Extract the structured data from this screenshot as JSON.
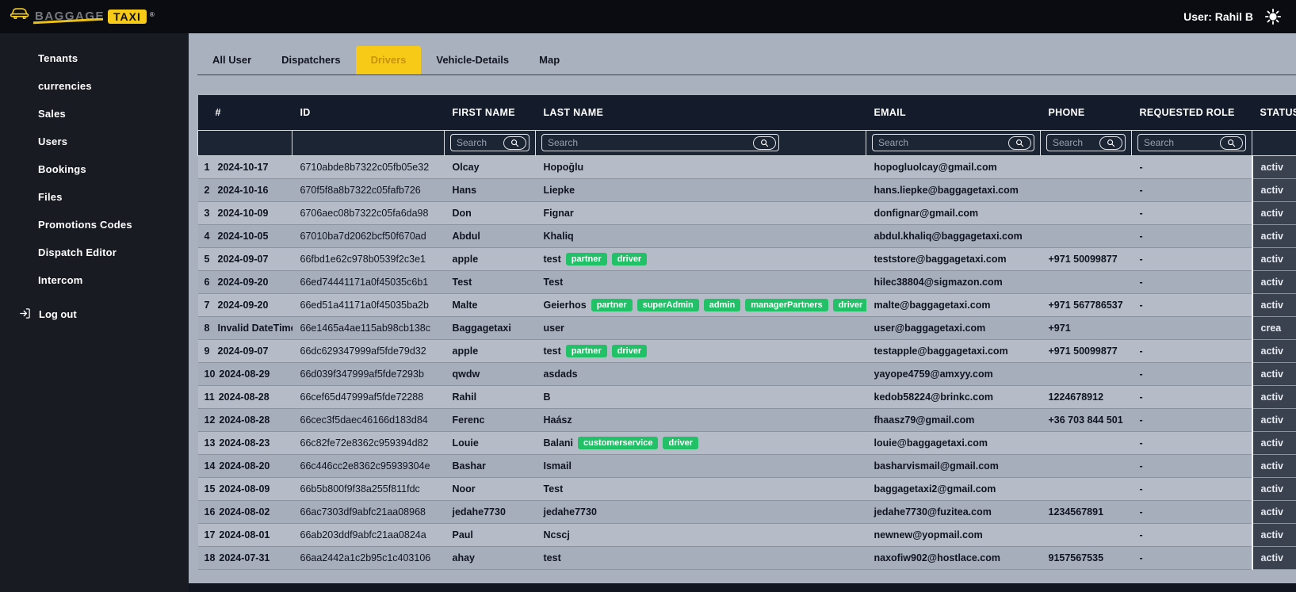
{
  "brand": {
    "name_baggage": "BAGGAGE",
    "name_taxi": "TAXI",
    "registered": "®"
  },
  "topbar": {
    "user_label": "User: Rahil B"
  },
  "sidebar": {
    "items": [
      "Tenants",
      "currencies",
      "Sales",
      "Users",
      "Bookings",
      "Files",
      "Promotions Codes",
      "Dispatch Editor",
      "Intercom"
    ],
    "logout_label": "Log out"
  },
  "tabs": {
    "items": [
      "All User",
      "Dispatchers",
      "Drivers",
      "Vehicle-Details",
      "Map"
    ],
    "active": "Drivers",
    "active_index": 2
  },
  "colors": {
    "accent_yellow": "#f7ca18",
    "tag_green": "#22c168",
    "header_bg": "#141c2b"
  },
  "table": {
    "columns": [
      "#",
      "ID",
      "FIRST NAME",
      "LAST NAME",
      "EMAIL",
      "PHONE",
      "REQUESTED ROLE",
      "STATUS"
    ],
    "search_placeholder": "Search",
    "search_inputs": [
      false,
      false,
      true,
      true,
      true,
      true,
      true,
      false
    ],
    "rows": [
      {
        "n": "1",
        "date": "2024-10-17",
        "id": "6710abde8b7322c05fb05e32",
        "first": "Olcay",
        "last": "Hopoğlu",
        "tags": [],
        "email": "hopogluolcay@gmail.com",
        "phone": "",
        "role": "-",
        "status": "activ"
      },
      {
        "n": "2",
        "date": "2024-10-16",
        "id": "670f5f8a8b7322c05fafb726",
        "first": "Hans",
        "last": "Liepke",
        "tags": [],
        "email": "hans.liepke@baggagetaxi.com",
        "phone": "",
        "role": "-",
        "status": "activ"
      },
      {
        "n": "3",
        "date": "2024-10-09",
        "id": "6706aec08b7322c05fa6da98",
        "first": "Don",
        "last": "Fignar",
        "tags": [],
        "email": "donfignar@gmail.com",
        "phone": "",
        "role": "-",
        "status": "activ"
      },
      {
        "n": "4",
        "date": "2024-10-05",
        "id": "67010ba7d2062bcf50f670ad",
        "first": "Abdul",
        "last": "Khaliq",
        "tags": [],
        "email": "abdul.khaliq@baggagetaxi.com",
        "phone": "",
        "role": "-",
        "status": "activ"
      },
      {
        "n": "5",
        "date": "2024-09-07",
        "id": "66fbd1e62c978b0539f2c3e1",
        "first": "apple",
        "last": "test",
        "tags": [
          "partner",
          "driver"
        ],
        "email": "teststore@baggagetaxi.com",
        "phone": "+971 50099877",
        "role": "-",
        "status": "activ"
      },
      {
        "n": "6",
        "date": "2024-09-20",
        "id": "66ed74441171a0f45035c6b1",
        "first": "Test",
        "last": "Test",
        "tags": [],
        "email": "hilec38804@sigmazon.com",
        "phone": "",
        "role": "-",
        "status": "activ"
      },
      {
        "n": "7",
        "date": "2024-09-20",
        "id": "66ed51a41171a0f45035ba2b",
        "first": "Malte",
        "last": "Geierhos",
        "tags": [
          "partner",
          "superAdmin",
          "admin",
          "managerPartners",
          "driver"
        ],
        "email": "malte@baggagetaxi.com",
        "phone": "+971 567786537",
        "role": "-",
        "status": "activ"
      },
      {
        "n": "8",
        "date": "Invalid DateTime",
        "id": "66e1465a4ae115ab98cb138c",
        "first": "Baggagetaxi",
        "last": "user",
        "tags": [],
        "email": "user@baggagetaxi.com",
        "phone": "+971",
        "role": "",
        "status": "crea"
      },
      {
        "n": "9",
        "date": "2024-09-07",
        "id": "66dc629347999af5fde79d32",
        "first": "apple",
        "last": "test",
        "tags": [
          "partner",
          "driver"
        ],
        "email": "testapple@baggagetaxi.com",
        "phone": "+971 50099877",
        "role": "-",
        "status": "activ"
      },
      {
        "n": "10",
        "date": "2024-08-29",
        "id": "66d039f347999af5fde7293b",
        "first": "qwdw",
        "last": "asdads",
        "tags": [],
        "email": "yayope4759@amxyy.com",
        "phone": "",
        "role": "-",
        "status": "activ"
      },
      {
        "n": "11",
        "date": "2024-08-28",
        "id": "66cef65d47999af5fde72288",
        "first": "Rahil",
        "last": "B",
        "tags": [],
        "email": "kedob58224@brinkc.com",
        "phone": "1224678912",
        "role": "-",
        "status": "activ"
      },
      {
        "n": "12",
        "date": "2024-08-28",
        "id": "66cec3f5daec46166d183d84",
        "first": "Ferenc",
        "last": "Haász",
        "tags": [],
        "email": "fhaasz79@gmail.com",
        "phone": "+36 703 844 501",
        "role": "-",
        "status": "activ"
      },
      {
        "n": "13",
        "date": "2024-08-23",
        "id": "66c82fe72e8362c959394d82",
        "first": "Louie",
        "last": "Balani",
        "tags": [
          "customerservice",
          "driver"
        ],
        "email": "louie@baggagetaxi.com",
        "phone": "",
        "role": "-",
        "status": "activ"
      },
      {
        "n": "14",
        "date": "2024-08-20",
        "id": "66c446cc2e8362c95939304e",
        "first": "Bashar",
        "last": "Ismail",
        "tags": [],
        "email": "basharvismail@gmail.com",
        "phone": "",
        "role": "-",
        "status": "activ"
      },
      {
        "n": "15",
        "date": "2024-08-09",
        "id": "66b5b800f9f38a255f811fdc",
        "first": "Noor",
        "last": "Test",
        "tags": [],
        "email": "baggagetaxi2@gmail.com",
        "phone": "",
        "role": "-",
        "status": "activ"
      },
      {
        "n": "16",
        "date": "2024-08-02",
        "id": "66ac7303df9abfc21aa08968",
        "first": "jedahe7730",
        "last": "jedahe7730",
        "tags": [],
        "email": "jedahe7730@fuzitea.com",
        "phone": "1234567891",
        "role": "-",
        "status": "activ"
      },
      {
        "n": "17",
        "date": "2024-08-01",
        "id": "66ab203ddf9abfc21aa0824a",
        "first": "Paul",
        "last": "Ncscj",
        "tags": [],
        "email": "newnew@yopmail.com",
        "phone": "",
        "role": "-",
        "status": "activ"
      },
      {
        "n": "18",
        "date": "2024-07-31",
        "id": "66aa2442a1c2b95c1c403106",
        "first": "ahay",
        "last": "test",
        "tags": [],
        "email": "naxofiw902@hostlace.com",
        "phone": "9157567535",
        "role": "-",
        "status": "activ"
      }
    ]
  }
}
